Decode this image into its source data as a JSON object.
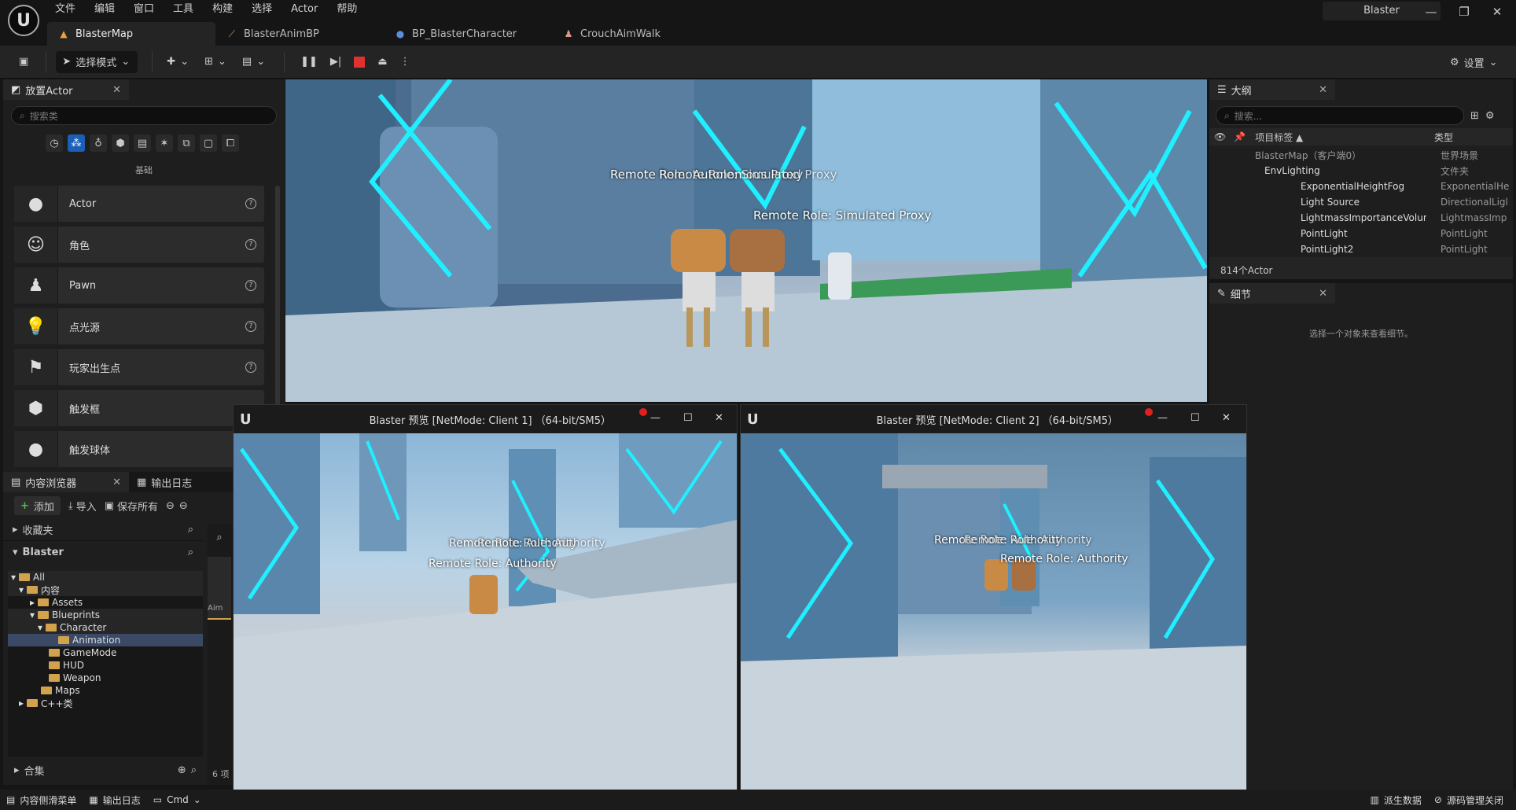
{
  "menubar": {
    "items": [
      "文件",
      "编辑",
      "窗口",
      "工具",
      "构建",
      "选择",
      "Actor",
      "帮助"
    ],
    "window_title": "Blaster"
  },
  "tabs": [
    {
      "label": "BlasterMap"
    },
    {
      "label": "BlasterAnimBP"
    },
    {
      "label": "BP_BlasterCharacter"
    },
    {
      "label": "CrouchAimWalk"
    }
  ],
  "toolbar": {
    "mode_label": "选择模式",
    "settings_label": "设置"
  },
  "place_actors": {
    "title": "放置Actor",
    "search_placeholder": "搜索类",
    "category": "基础",
    "items": [
      {
        "label": "Actor"
      },
      {
        "label": "角色"
      },
      {
        "label": "Pawn"
      },
      {
        "label": "点光源"
      },
      {
        "label": "玩家出生点"
      },
      {
        "label": "触发框"
      },
      {
        "label": "触发球体"
      }
    ]
  },
  "content_browser": {
    "title": "内容浏览器",
    "output_log_tab": "输出日志",
    "add_label": "添加",
    "import_label": "导入",
    "save_all_label": "保存所有",
    "favorites_label": "收藏夹",
    "project_label": "Blaster",
    "collections_label": "合集",
    "tree": [
      "All",
      "内容",
      "Assets",
      "Blueprints",
      "Character",
      "Animation",
      "GameMode",
      "HUD",
      "Weapon",
      "Maps",
      "C++类"
    ],
    "asset_partial": "Aim",
    "item_count": "6 项"
  },
  "outliner": {
    "title": "大纲",
    "search_placeholder": "搜索...",
    "col_label": "项目标签 ▲",
    "col_type": "类型",
    "rows": [
      {
        "name": "BlasterMap（客户端0）",
        "type": "世界场景"
      },
      {
        "name": "EnvLighting",
        "type": "文件夹"
      },
      {
        "name": "ExponentialHeightFog",
        "type": "ExponentialHe"
      },
      {
        "name": "Light Source",
        "type": "DirectionalLigl"
      },
      {
        "name": "LightmassImportanceVolun",
        "type": "LightmassImp"
      },
      {
        "name": "PointLight",
        "type": "PointLight"
      },
      {
        "name": "PointLight2",
        "type": "PointLight"
      }
    ],
    "actor_count": "814个Actor"
  },
  "details": {
    "title": "细节",
    "empty_text": "选择一个对象来查看细节。"
  },
  "main_viewport": {
    "labels": [
      "Remote Role: Autonomous Proxy",
      "Remote Role: Simulated Proxy",
      "Remote Role: Simulated Proxy"
    ]
  },
  "client1": {
    "title": "Blaster 预览 [NetMode: Client 1] （64-bit/SM5）",
    "labels": [
      "Remote Role: Authority",
      "Remote Role: Authority",
      "Remote Role: Authority"
    ]
  },
  "client2": {
    "title": "Blaster 预览 [NetMode: Client 2] （64-bit/SM5）",
    "labels": [
      "Remote Role: Authority",
      "Remote Role: Authority",
      "Remote Role: Authority"
    ]
  },
  "bottombar": {
    "drawer": "内容侧滑菜单",
    "output_log": "输出日志",
    "cmd": "Cmd",
    "derived_data": "派生数据",
    "source_control": "源码管理关闭"
  }
}
